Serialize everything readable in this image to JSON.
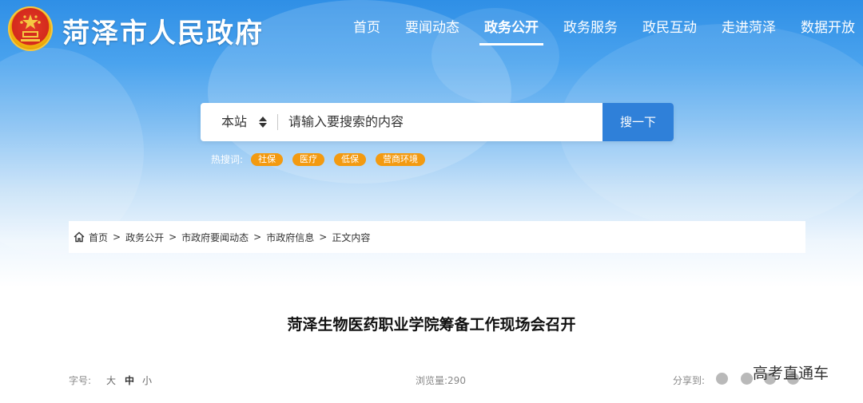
{
  "header": {
    "site_title": "菏泽市人民政府",
    "nav": [
      {
        "label": "首页",
        "active": false
      },
      {
        "label": "要闻动态",
        "active": false
      },
      {
        "label": "政务公开",
        "active": true
      },
      {
        "label": "政务服务",
        "active": false
      },
      {
        "label": "政民互动",
        "active": false
      },
      {
        "label": "走进菏泽",
        "active": false
      },
      {
        "label": "数据开放",
        "active": false
      }
    ]
  },
  "search": {
    "scope": "本站",
    "placeholder": "请输入要搜索的内容",
    "button": "搜一下"
  },
  "hot_search": {
    "label": "热搜词:",
    "tags": [
      "社保",
      "医疗",
      "低保",
      "营商环境"
    ]
  },
  "breadcrumb": [
    "首页",
    "政务公开",
    "市政府要闻动态",
    "市政府信息",
    "正文内容"
  ],
  "article": {
    "title": "菏泽生物医药职业学院筹备工作现场会召开"
  },
  "meta": {
    "font_size_label": "字号:",
    "font_sizes": [
      "大",
      "中",
      "小"
    ],
    "views_label": "浏览量:",
    "views": "290",
    "share_label": "分享到:"
  },
  "watermark": "高考直通车",
  "colors": {
    "primary_blue": "#2f80d9",
    "hot_tag": "#f39a10"
  },
  "icons": [
    "emblem",
    "home-icon",
    "sort-caret-icon",
    "wechat-icon",
    "weibo-icon",
    "share-icon-3",
    "share-icon-4"
  ]
}
